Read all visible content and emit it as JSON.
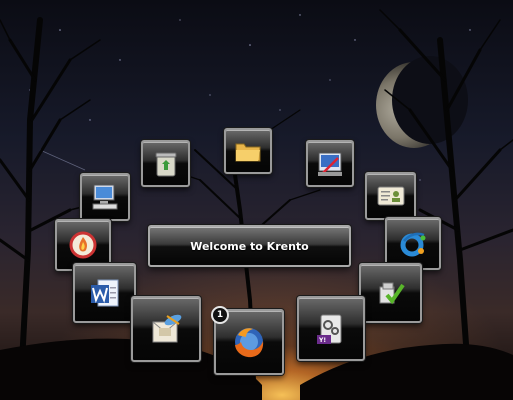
{
  "welcome": {
    "text": "Welcome to Krento"
  },
  "firefox_badge": {
    "count": "1"
  },
  "dock": {
    "items": [
      {
        "icon": "recycle-bin-icon"
      },
      {
        "icon": "folder-icon"
      },
      {
        "icon": "control-panel-icon"
      },
      {
        "icon": "my-computer-icon"
      },
      {
        "icon": "contact-card-icon"
      },
      {
        "icon": "firewall-icon"
      },
      {
        "icon": "ie-dock-icon"
      },
      {
        "icon": "word-icon"
      },
      {
        "icon": "checklist-icon"
      },
      {
        "icon": "mail-icon"
      },
      {
        "icon": "firefox-icon"
      },
      {
        "icon": "yahoo-widget-icon"
      }
    ]
  },
  "colors": {
    "glow": "#ffb84a",
    "tile_border": "#9a9a9a",
    "badge_bg": "#111111"
  }
}
